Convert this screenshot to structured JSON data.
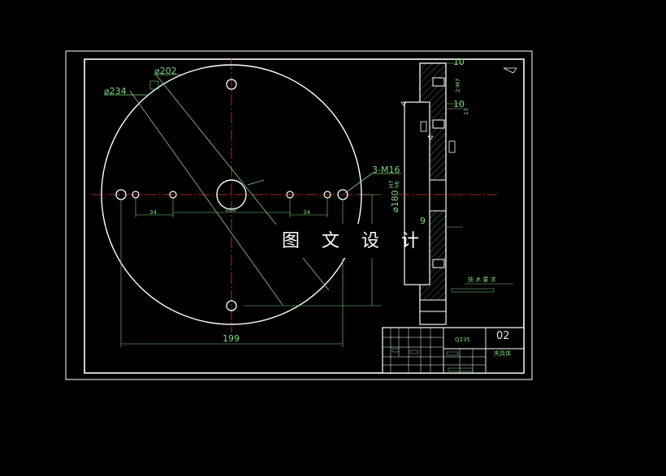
{
  "watermark": "图 文 设 计",
  "dimensions": {
    "d202": "⌀202",
    "d234": "⌀234",
    "thread": "3-M16",
    "spacing_left": "34",
    "center": "100",
    "spacing_right": "34",
    "overall": "199",
    "bore": "⌀180",
    "bore_fit_upper": "H7",
    "bore_fit_lower": "h6"
  },
  "section_dims": {
    "top": "10",
    "hole_depth": "2-M7",
    "mid": "10",
    "mid2": "13",
    "lower": "9"
  },
  "tech_requirements": "技 术 要 求",
  "title_block": {
    "material": "Q235",
    "drawing_no": "02",
    "part_name": "夹具体"
  },
  "colors": {
    "background": "#000000",
    "outline": "#ffffff",
    "dimension": "#7fd37f",
    "centerline": "#d83a3a"
  }
}
